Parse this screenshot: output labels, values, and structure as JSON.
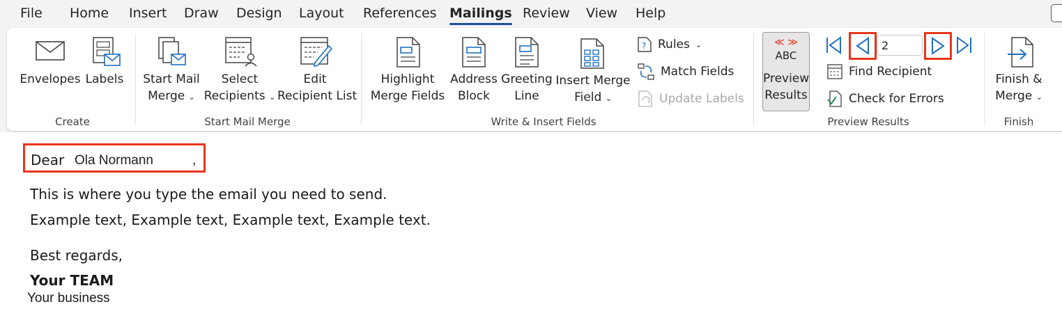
{
  "tabs": [
    "File",
    "Home",
    "Insert",
    "Draw",
    "Design",
    "Layout",
    "References",
    "Mailings",
    "Review",
    "View",
    "Help"
  ],
  "active_tab": "Mailings",
  "ribbon": {
    "create": {
      "label": "Create",
      "envelopes": "Envelopes",
      "labels": "Labels"
    },
    "start_mail_merge": {
      "label": "Start Mail Merge",
      "start_line1": "Start Mail",
      "start_line2": "Merge",
      "select_line1": "Select",
      "select_line2": "Recipients",
      "edit_line1": "Edit",
      "edit_line2": "Recipient List"
    },
    "write_insert": {
      "label": "Write & Insert Fields",
      "highlight_line1": "Highlight",
      "highlight_line2": "Merge Fields",
      "address_line1": "Address",
      "address_line2": "Block",
      "greeting_line1": "Greeting",
      "greeting_line2": "Line",
      "insert_line1": "Insert Merge",
      "insert_line2": "Field",
      "rules": "Rules",
      "match_fields": "Match Fields",
      "update_labels": "Update Labels"
    },
    "preview": {
      "label": "Preview Results",
      "abc": "ABC",
      "preview_line1": "Preview",
      "preview_line2": "Results",
      "record_value": "2",
      "find_recipient": "Find Recipient",
      "check_errors": "Check for Errors"
    },
    "finish": {
      "label": "Finish",
      "finish_line1": "Finish &",
      "finish_line2": "Merge"
    }
  },
  "colors": {
    "accent_blue": "#1f6fc0",
    "highlight_red": "#e8361b",
    "tab_underline": "#1f4e9c"
  },
  "document": {
    "dear": "Dear",
    "recipient_name": "Ola Normann",
    "comma": ",",
    "line1": "This is where you type the email you need to send.",
    "line2": "Example text, Example text, Example text, Example text.",
    "regards": "Best regards,",
    "team": "Your TEAM",
    "business": "Your business"
  }
}
